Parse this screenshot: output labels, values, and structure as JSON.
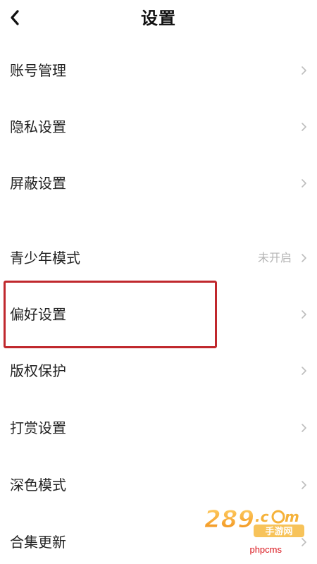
{
  "header": {
    "title": "设置"
  },
  "menu": {
    "items": [
      {
        "label": "账号管理",
        "status": ""
      },
      {
        "label": "隐私设置",
        "status": ""
      },
      {
        "label": "屏蔽设置",
        "status": ""
      },
      {
        "label": "青少年模式",
        "status": "未开启"
      },
      {
        "label": "偏好设置",
        "status": ""
      },
      {
        "label": "版权保护",
        "status": ""
      },
      {
        "label": "打赏设置",
        "status": ""
      },
      {
        "label": "深色模式",
        "status": ""
      },
      {
        "label": "合集更新",
        "status": ""
      }
    ]
  },
  "watermark": {
    "logo_text": "289.com 手游网",
    "site_text": "phpcms"
  },
  "colors": {
    "highlight_border": "#c0282d",
    "secondary_text": "#b5b5b5",
    "watermark_orange": "#f2a424",
    "watermark_red": "#d9141b"
  }
}
